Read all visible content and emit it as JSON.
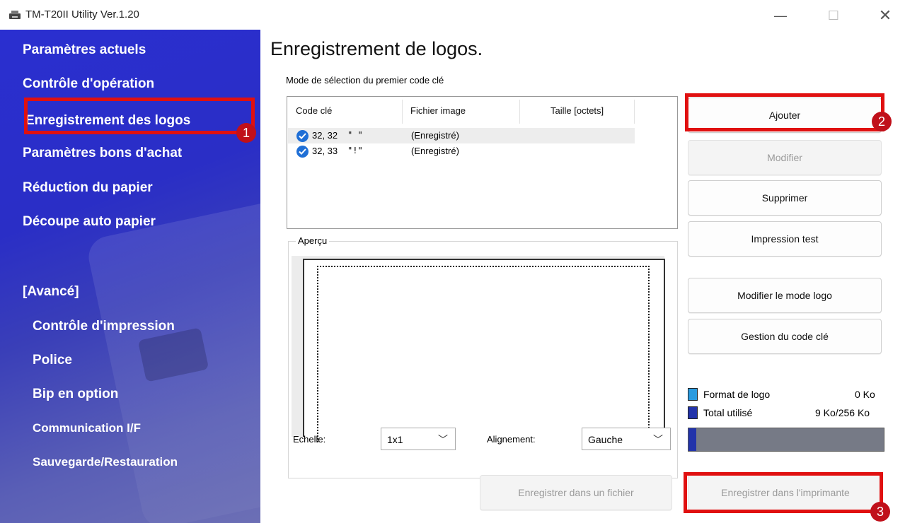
{
  "window": {
    "title": "TM-T20II Utility Ver.1.20",
    "controls": {
      "minimize": "—",
      "maximize": "☐",
      "close": "✕"
    }
  },
  "sidebar": {
    "items": [
      {
        "label": "Paramètres actuels"
      },
      {
        "label": "Contrôle d'opération"
      },
      {
        "label": "Enregistrement des logos",
        "selected": true
      },
      {
        "label": "Paramètres bons d'achat"
      },
      {
        "label": "Réduction du papier"
      },
      {
        "label": "Découpe auto papier"
      }
    ],
    "advanced_header": "[Avancé]",
    "advanced_items": [
      {
        "label": "Contrôle d'impression"
      },
      {
        "label": "Police"
      },
      {
        "label": "Bip en option"
      },
      {
        "label": "Communication I/F"
      },
      {
        "label": "Sauvegarde/Restauration"
      }
    ]
  },
  "annotations": {
    "badge1": "1",
    "badge2": "2",
    "badge3": "3",
    "color": "#e01010"
  },
  "main": {
    "title": "Enregistrement de logos.",
    "mode_label": "Mode de sélection du premier code clé",
    "table": {
      "columns": [
        "Code clé",
        "Fichier image",
        "Taille [octets]"
      ],
      "rows": [
        {
          "code": "32, 32",
          "char": "\" \"",
          "file": "(Enregistré)",
          "size": "",
          "selected": true
        },
        {
          "code": "32, 33",
          "char": "\"!\"",
          "file": "(Enregistré)",
          "size": "",
          "selected": false
        }
      ]
    },
    "preview": {
      "label": "Aperçu",
      "scale_label": "Echelle:",
      "scale_value": "1x1",
      "align_label": "Alignement:",
      "align_value": "Gauche"
    },
    "buttons": {
      "add": "Ajouter",
      "modify": "Modifier",
      "delete": "Supprimer",
      "test_print": "Impression test",
      "change_logo_mode": "Modifier le mode logo",
      "key_code_mgmt": "Gestion du code clé",
      "save_file": "Enregistrer dans un fichier",
      "save_printer": "Enregistrer dans l'imprimante"
    },
    "usage": {
      "logo_format_label": "Format de logo",
      "logo_format_value": "0 Ko",
      "total_used_label": "Total utilisé",
      "total_used_value": "9 Ko/256 Ko",
      "logo_color": "#2a9be0",
      "total_color": "#2233aa",
      "total_fraction": 0.035
    }
  }
}
